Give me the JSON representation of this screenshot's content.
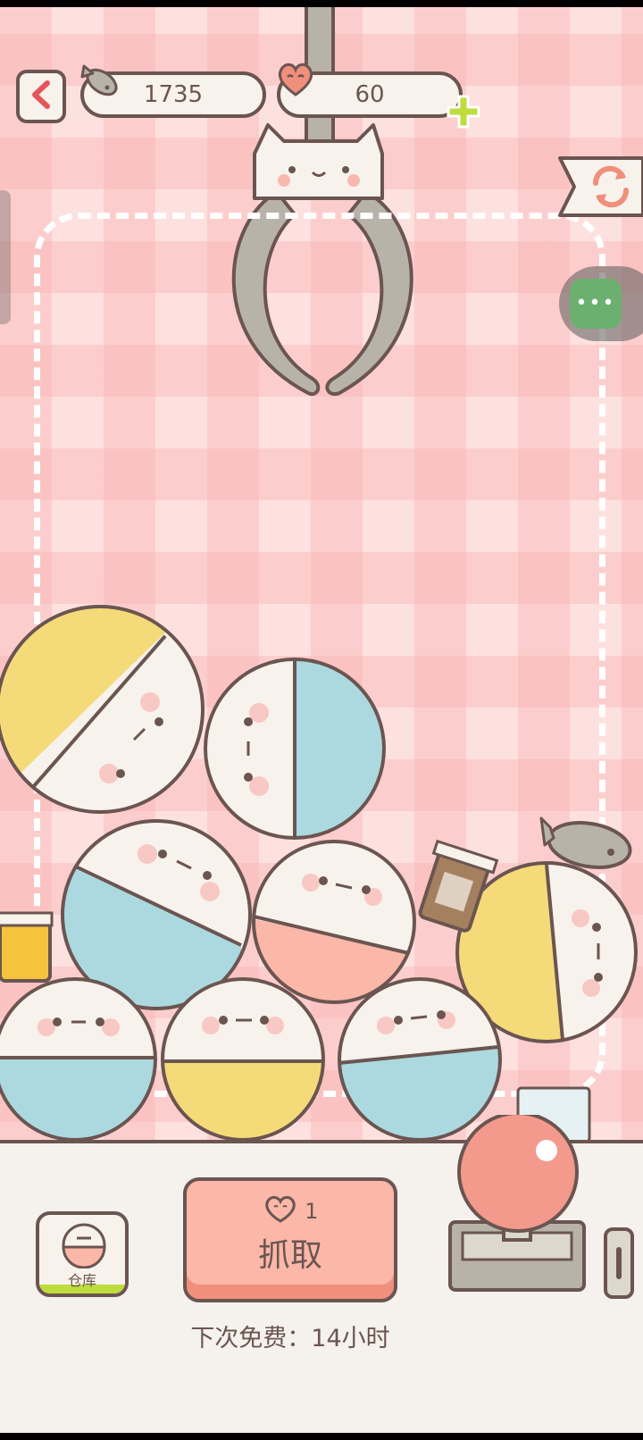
{
  "currency": {
    "fish_icon": "fish-icon",
    "fish_count": "1735",
    "heart_icon": "heart-icon",
    "heart_count": "60"
  },
  "controls": {
    "back_icon": "chevron-left-icon",
    "add_icon": "plus-icon",
    "swap_icon": "refresh-icon",
    "more_icon": "ellipsis-icon"
  },
  "grab": {
    "cost": "1",
    "label": "抓取",
    "cost_icon": "heart-icon"
  },
  "next_free": "下次免费：14小时",
  "warehouse": {
    "label": "仓库"
  },
  "colors": {
    "background": "#fde1df",
    "outline": "#6b5551",
    "yellow": "#f5da79",
    "blue": "#acd9e0",
    "pink": "#fbb7a8",
    "cream": "#f7f2ec",
    "green": "#bedc3c"
  },
  "capsules": [
    {
      "color": "yellow"
    },
    {
      "color": "blue"
    },
    {
      "color": "blue"
    },
    {
      "color": "pink"
    },
    {
      "color": "yellow"
    },
    {
      "color": "blue"
    },
    {
      "color": "yellow"
    },
    {
      "color": "blue"
    }
  ]
}
